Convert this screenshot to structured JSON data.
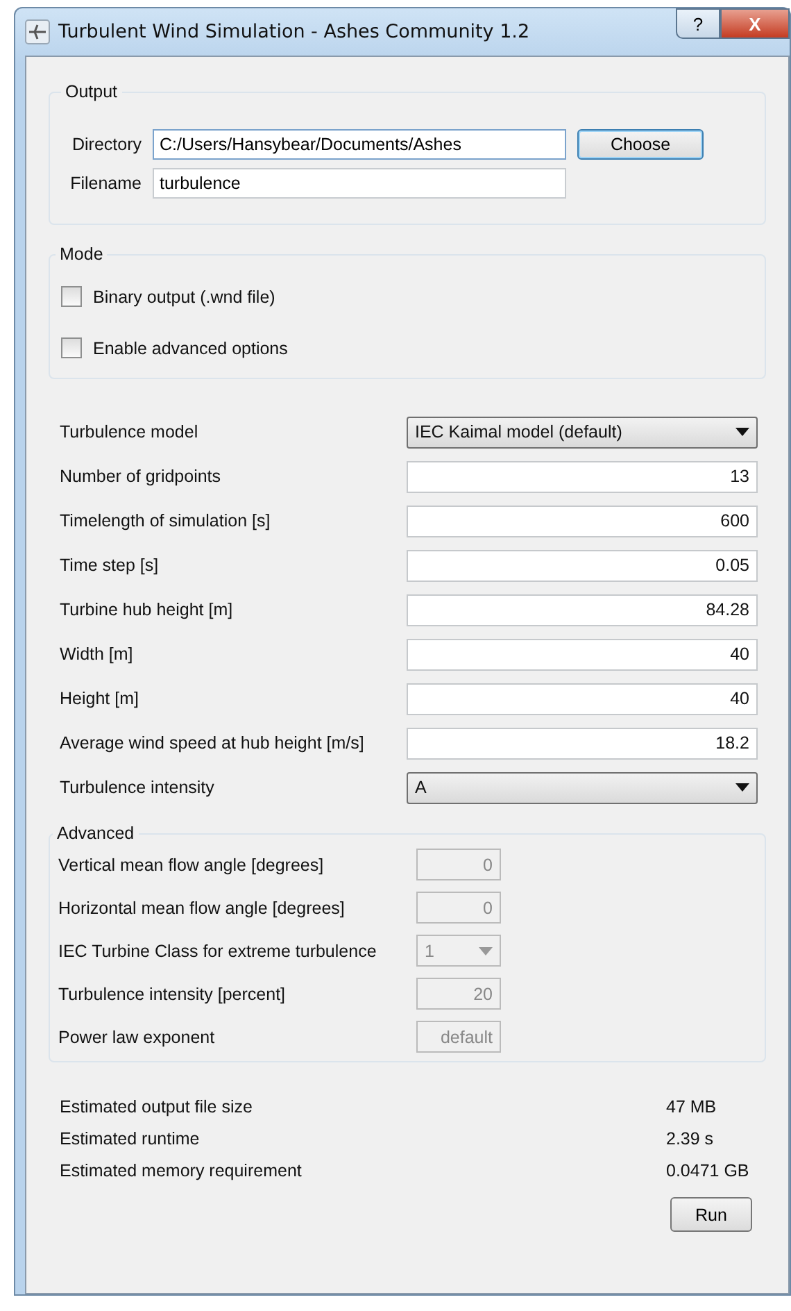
{
  "window": {
    "title": "Turbulent Wind Simulation - Ashes Community 1.2",
    "help": "?",
    "close": "X"
  },
  "output": {
    "title": "Output",
    "directory_label": "Directory",
    "directory": "C:/Users/Hansybear/Documents/Ashes",
    "choose": "Choose",
    "filename_label": "Filename",
    "filename": "turbulence"
  },
  "mode": {
    "title": "Mode",
    "options": [
      {
        "label": "Binary output (.wnd file)",
        "checked": false
      },
      {
        "label": "Enable advanced options",
        "checked": false
      }
    ]
  },
  "parameters": [
    {
      "kind": "dropdown",
      "label": "Turbulence model",
      "value": "IEC Kaimal model (default)"
    },
    {
      "kind": "number",
      "label": "Number of gridpoints",
      "value": "13"
    },
    {
      "kind": "number",
      "label": "Timelength of simulation [s]",
      "value": "600"
    },
    {
      "kind": "number",
      "label": "Time step [s]",
      "value": "0.05"
    },
    {
      "kind": "number",
      "label": "Turbine hub height [m]",
      "value": "84.28"
    },
    {
      "kind": "number",
      "label": "Width [m]",
      "value": "40"
    },
    {
      "kind": "number",
      "label": "Height [m]",
      "value": "40"
    },
    {
      "kind": "number",
      "label": "Average wind speed at hub height [m/s]",
      "value": "18.2"
    },
    {
      "kind": "dropdown",
      "label": "Turbulence intensity",
      "value": "A"
    }
  ],
  "advanced": {
    "title": "Advanced",
    "rows": [
      {
        "kind": "number",
        "label": "Vertical mean flow angle [degrees]",
        "value": "0",
        "disabled": true
      },
      {
        "kind": "number",
        "label": "Horizontal mean flow angle [degrees]",
        "value": "0",
        "disabled": true
      },
      {
        "kind": "dropdown",
        "label": "IEC Turbine Class for extreme turbulence",
        "value": "1",
        "disabled": true
      },
      {
        "kind": "number",
        "label": "Turbulence intensity [percent]",
        "value": "20",
        "disabled": true
      },
      {
        "kind": "number",
        "label": "Power law exponent",
        "value": "default",
        "disabled": true
      }
    ]
  },
  "estimates": [
    {
      "label": "Estimated output file size",
      "value": "47 MB"
    },
    {
      "label": "Estimated runtime",
      "value": "2.39 s"
    },
    {
      "label": "Estimated memory requirement",
      "value": "0.0471 GB"
    }
  ],
  "run": "Run"
}
